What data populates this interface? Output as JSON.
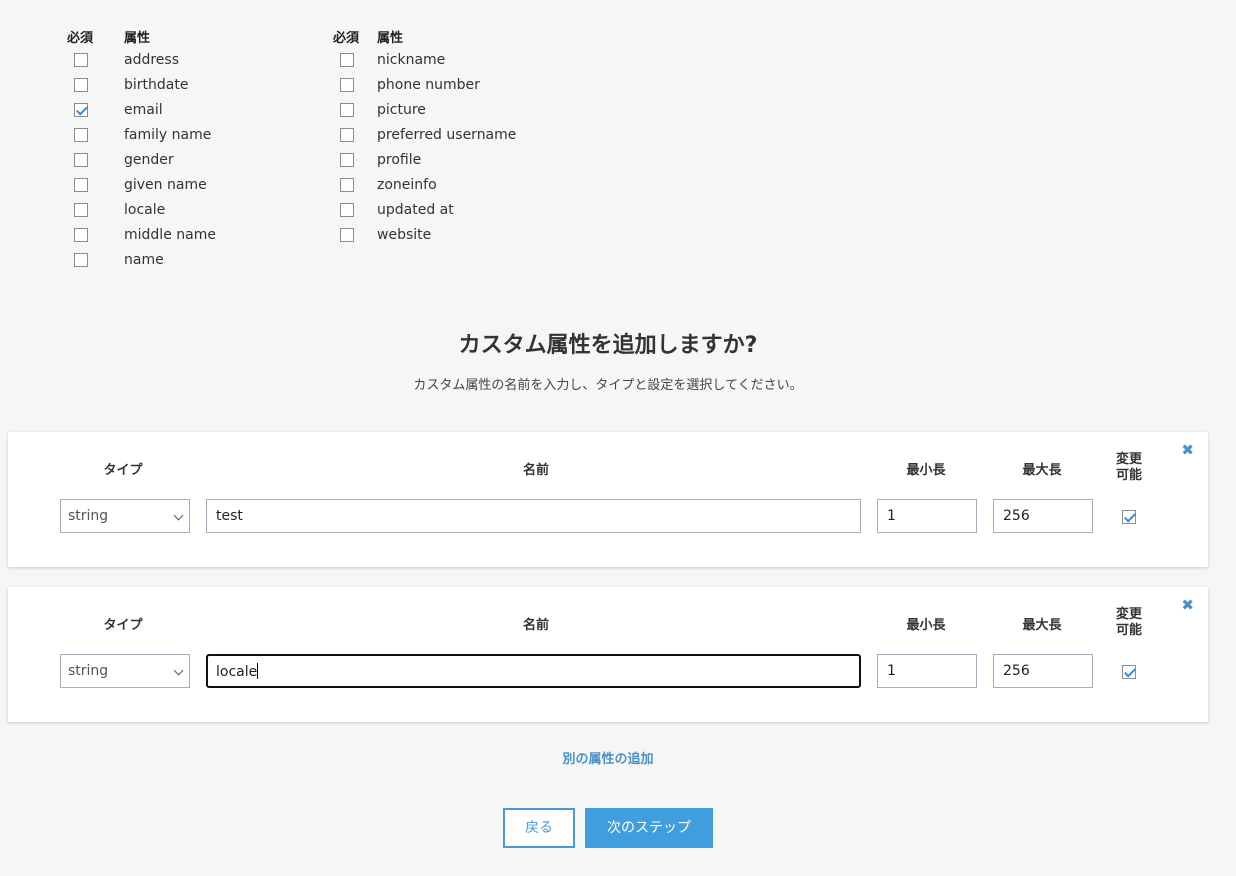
{
  "standard_attributes": {
    "header_required": "必須",
    "header_attribute": "属性",
    "left": [
      {
        "label": "address",
        "required": false
      },
      {
        "label": "birthdate",
        "required": false
      },
      {
        "label": "email",
        "required": true
      },
      {
        "label": "family name",
        "required": false
      },
      {
        "label": "gender",
        "required": false
      },
      {
        "label": "given name",
        "required": false
      },
      {
        "label": "locale",
        "required": false
      },
      {
        "label": "middle name",
        "required": false
      },
      {
        "label": "name",
        "required": false
      }
    ],
    "right": [
      {
        "label": "nickname",
        "required": false
      },
      {
        "label": "phone number",
        "required": false
      },
      {
        "label": "picture",
        "required": false
      },
      {
        "label": "preferred username",
        "required": false
      },
      {
        "label": "profile",
        "required": false
      },
      {
        "label": "zoneinfo",
        "required": false
      },
      {
        "label": "updated at",
        "required": false
      },
      {
        "label": "website",
        "required": false
      }
    ]
  },
  "custom": {
    "title": "カスタム属性を追加しますか?",
    "subtitle": "カスタム属性の名前を入力し、タイプと設定を選択してください。",
    "headers": {
      "type": "タイプ",
      "name": "名前",
      "min_length": "最小長",
      "max_length": "最大長",
      "mutable_line1": "変更",
      "mutable_line2": "可能"
    },
    "remove_glyph": "✖",
    "rows": [
      {
        "type": "string",
        "name": "test",
        "min": "1",
        "max": "256",
        "mutable": true,
        "focused": false
      },
      {
        "type": "string",
        "name": "locale",
        "min": "1",
        "max": "256",
        "mutable": true,
        "focused": true
      }
    ],
    "add_another": "別の属性の追加"
  },
  "footer": {
    "back_label": "戻る",
    "next_label": "次のステップ"
  },
  "colors": {
    "accent": "#3f9ede",
    "link": "#4a90c8",
    "background": "#f5f6f6"
  }
}
